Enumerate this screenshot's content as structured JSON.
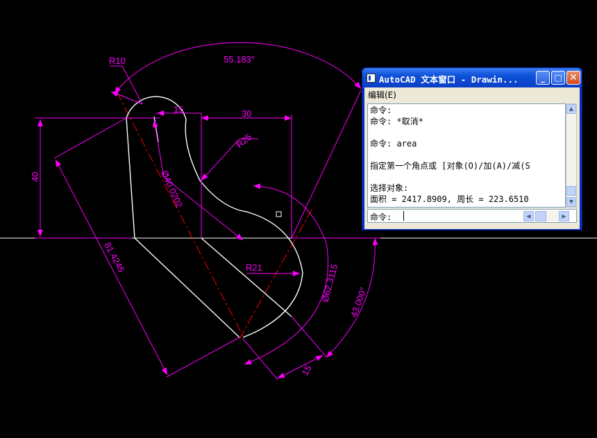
{
  "drawing": {
    "dimensions": {
      "r10": "R10",
      "angle_top": "55.183°",
      "d15_top": "15",
      "d30": "30",
      "r25": "R25",
      "d40": "40",
      "dia_40": "Ø40.0202",
      "d81": "81.4245",
      "r21": "R21",
      "dia_62": "Ø62.3115",
      "angle_bottom": "43.000°",
      "d15_bottom": "15"
    },
    "colors": {
      "background": "#000000",
      "geometry": "#ffffff",
      "dimension": "#ff00ff",
      "centerline": "#ff0000"
    }
  },
  "textwindow": {
    "title": "AutoCAD 文本窗口 - Drawin...",
    "menu": {
      "edit": "编辑(E)"
    },
    "history": [
      "命令:",
      "命令: *取消*",
      "命令: area",
      "指定第一个角点或 [对象(O)/加(A)/减(S",
      "选择对象:",
      "面积 = 2417.8909, 周长 = 223.6510"
    ],
    "prompt": "命令:",
    "input_value": "",
    "icons": {
      "window": "app-icon",
      "minimize": "minimize-icon",
      "maximize": "maximize-icon",
      "close": "close-icon"
    }
  }
}
